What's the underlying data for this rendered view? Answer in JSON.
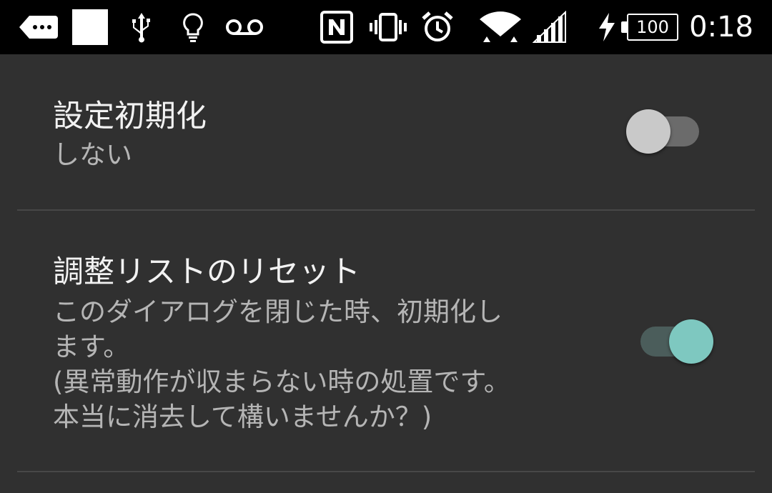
{
  "status_bar": {
    "icons_left": [
      "more-notifications-icon",
      "blank-square-icon",
      "usb-icon",
      "lightbulb-icon",
      "voicemail-icon"
    ],
    "icons_right": [
      "nfc-icon",
      "vibrate-icon",
      "alarm-clock-icon",
      "wifi-icon",
      "cell-signal-icon",
      "charging-icon"
    ],
    "battery_level": "100",
    "time": "0:18"
  },
  "preferences": [
    {
      "title": "設定初期化",
      "summary": "しない",
      "switch_on": false
    },
    {
      "title": "調整リストのリセット",
      "summary_lines": [
        "このダイアログを閉じた時、初期化し",
        "ます。",
        "(異常動作が収まらない時の処置です。",
        "本当に消去して構いませんか？)"
      ],
      "switch_on": true
    }
  ],
  "colors": {
    "background": "#303030",
    "status_bar": "#000000",
    "switch_on_thumb": "#7ec8c0",
    "switch_off_thumb": "#c9c9c9"
  }
}
